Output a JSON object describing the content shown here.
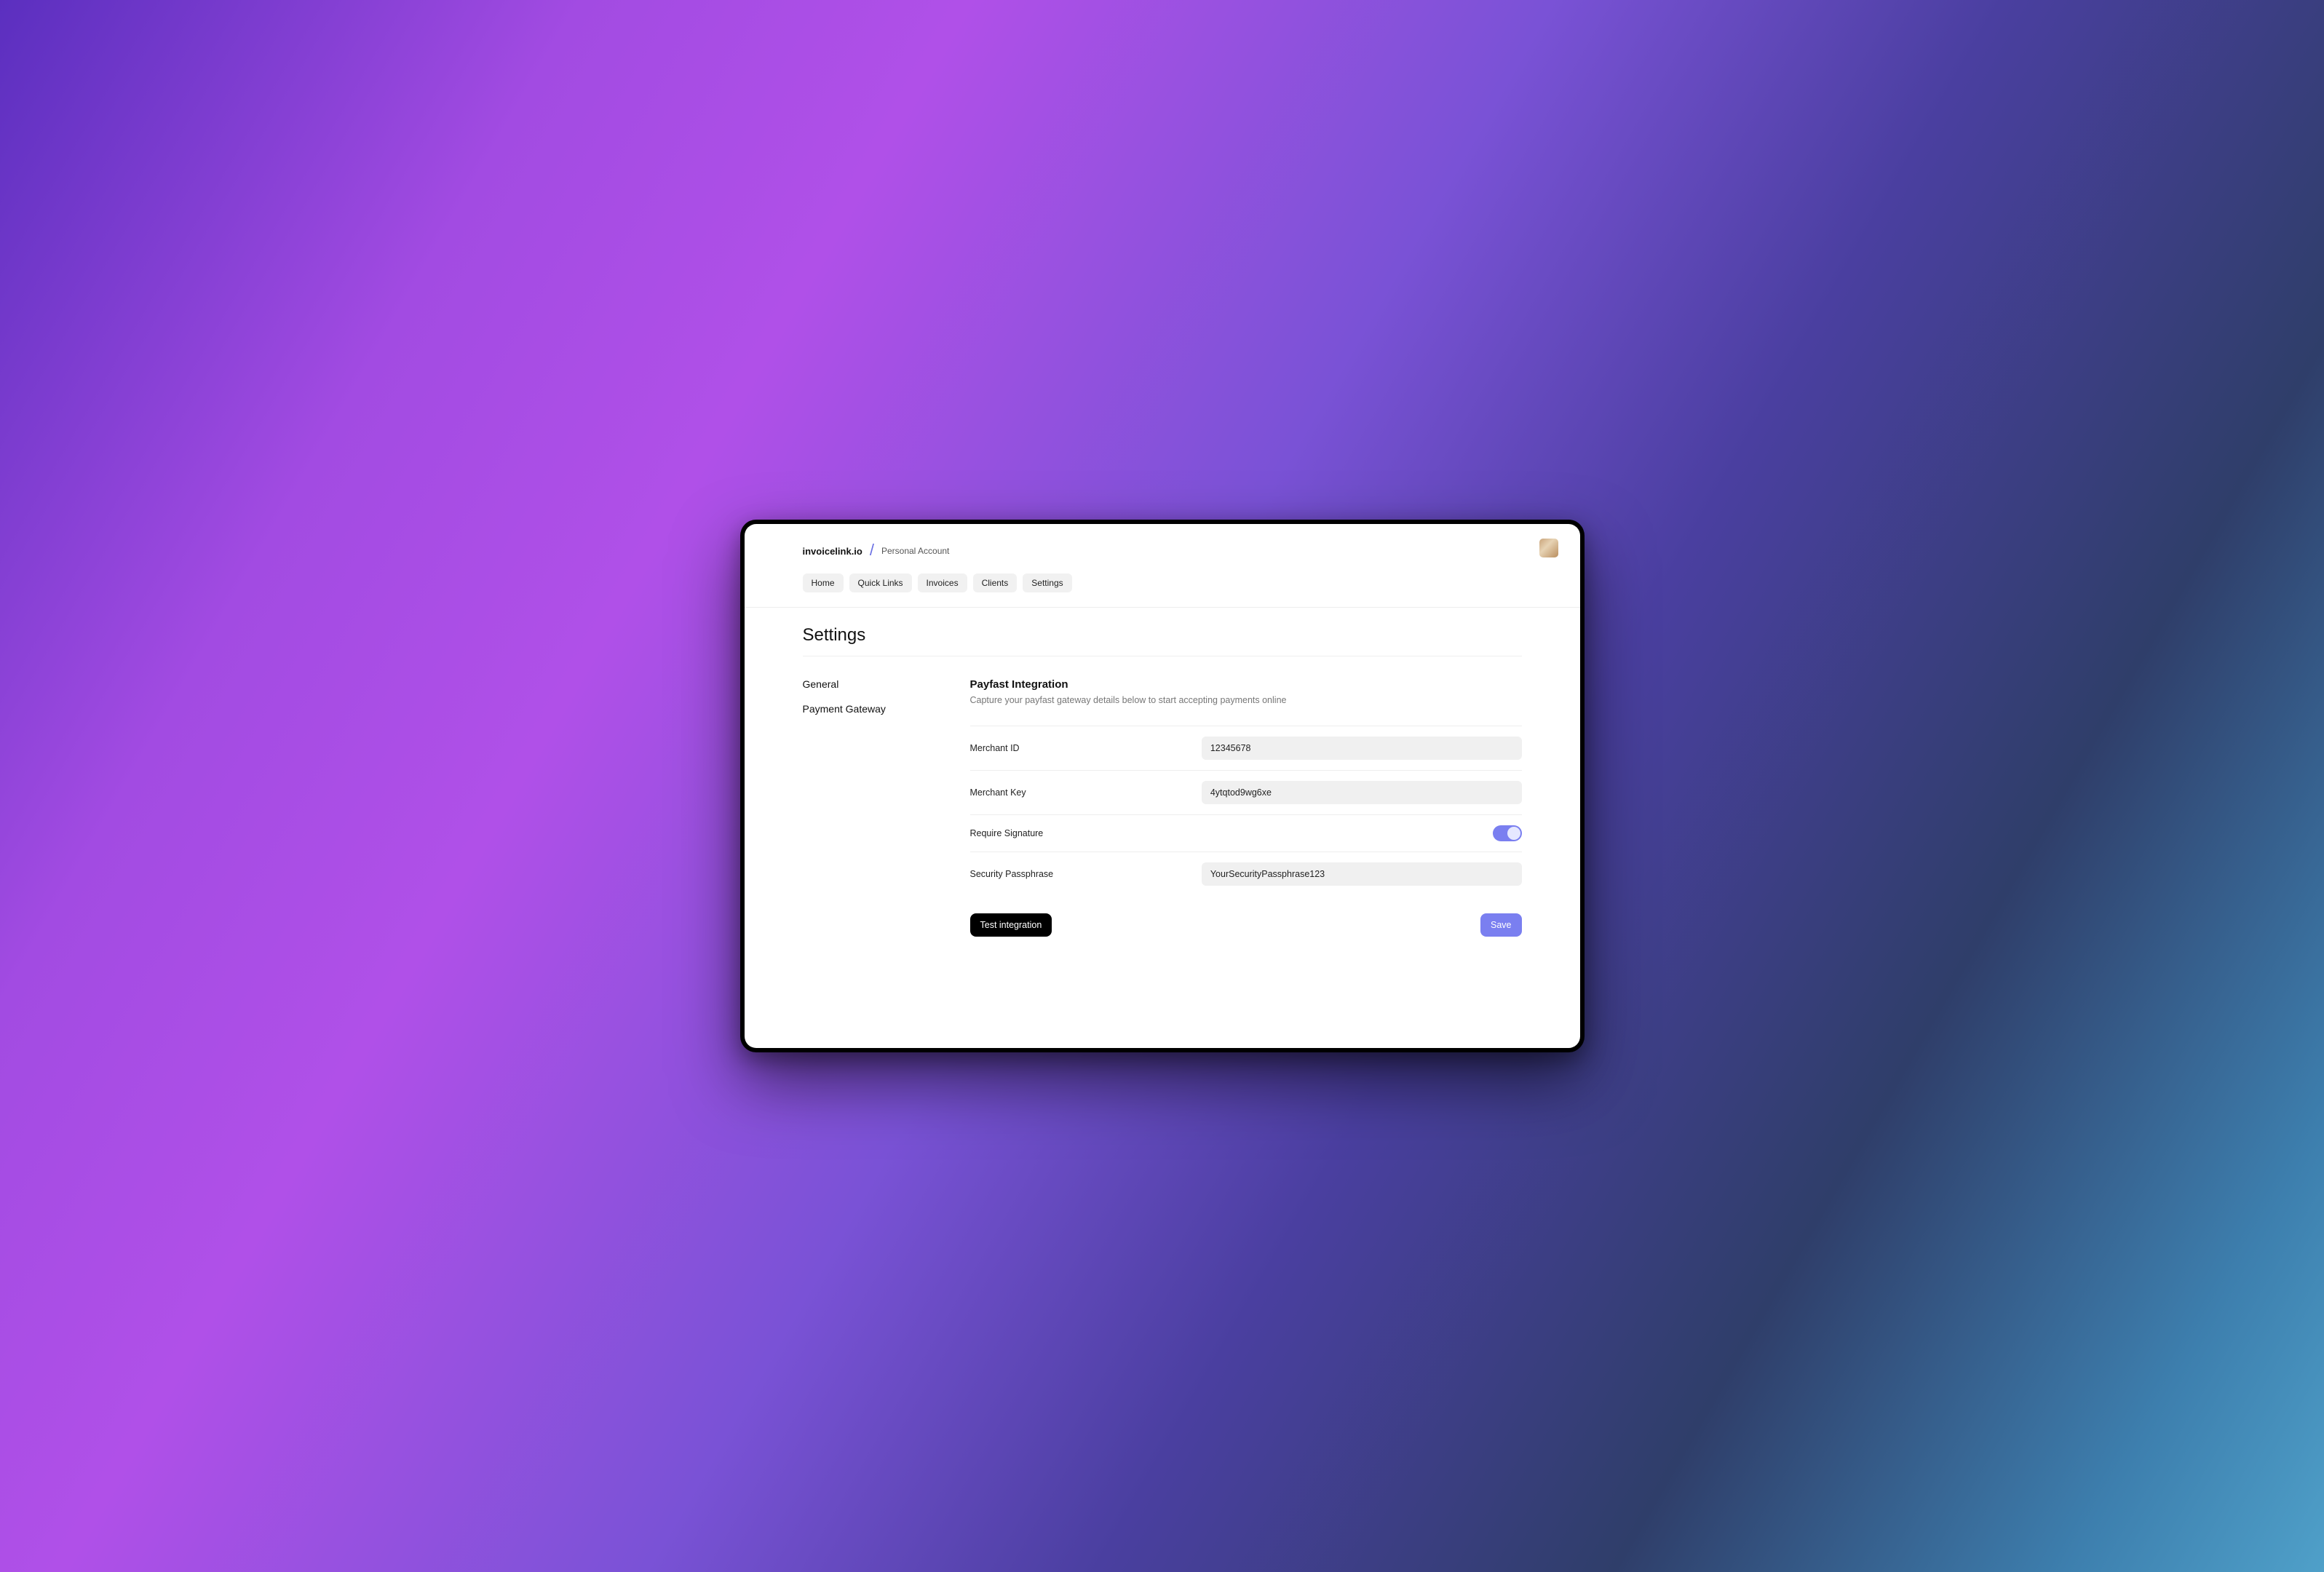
{
  "header": {
    "brand": "invoicelink.io",
    "account": "Personal Account"
  },
  "nav": {
    "items": [
      "Home",
      "Quick Links",
      "Invoices",
      "Clients",
      "Settings"
    ]
  },
  "page": {
    "title": "Settings"
  },
  "sidebar": {
    "items": [
      "General",
      "Payment Gateway"
    ]
  },
  "panel": {
    "title": "Payfast Integration",
    "subtitle": "Capture your payfast gateway details below to start accepting payments online",
    "fields": {
      "merchant_id": {
        "label": "Merchant ID",
        "value": "12345678"
      },
      "merchant_key": {
        "label": "Merchant Key",
        "value": "4ytqtod9wg6xe"
      },
      "require_signature": {
        "label": "Require Signature",
        "value": true
      },
      "security_passphrase": {
        "label": "Security Passphrase",
        "value": "YourSecurityPassphrase123"
      }
    },
    "actions": {
      "test": "Test integration",
      "save": "Save"
    }
  },
  "colors": {
    "accent": "#7a7ff0"
  }
}
